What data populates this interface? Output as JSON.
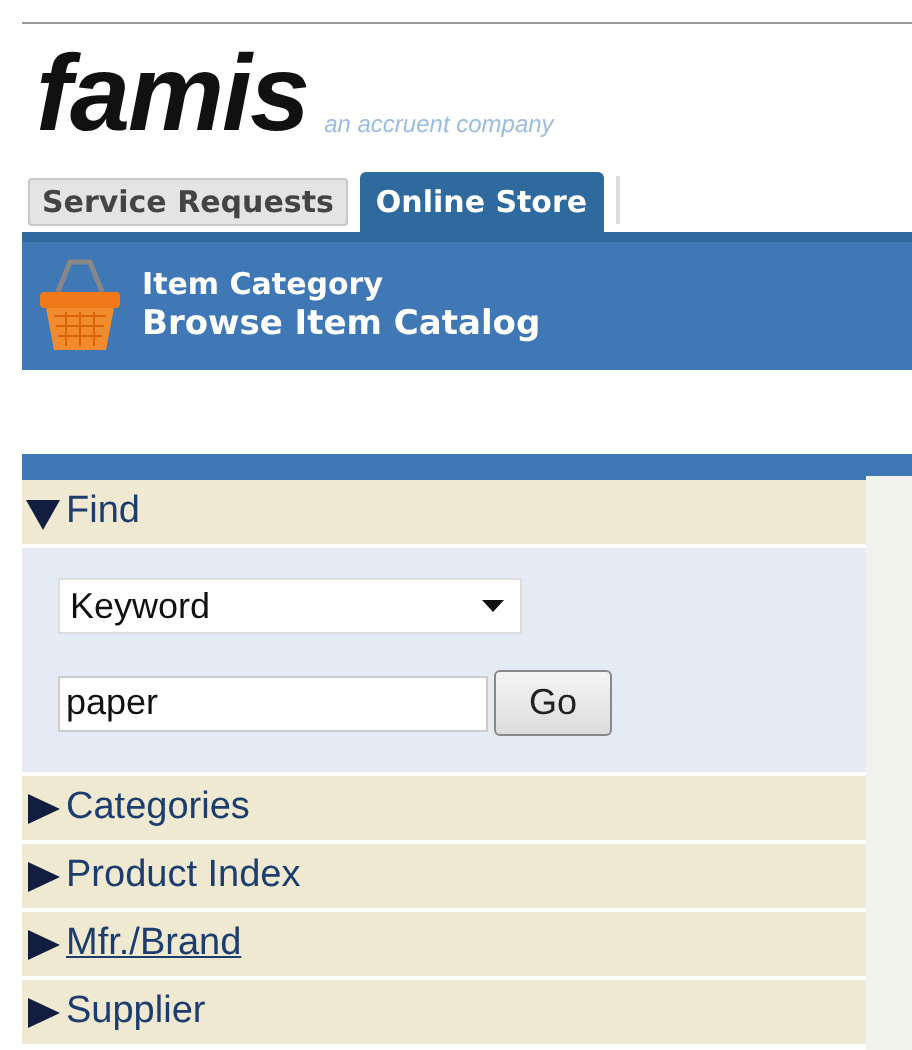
{
  "logo": {
    "brand": "famis",
    "tagline": "an accruent company"
  },
  "tabs": [
    {
      "label": "Service Requests",
      "selected": false
    },
    {
      "label": "Online Store",
      "selected": true
    }
  ],
  "header": {
    "subtitle": "Item Category",
    "title": "Browse Item Catalog"
  },
  "sections": [
    {
      "label": "Find",
      "expanded": true,
      "hovered": false
    },
    {
      "label": "Categories",
      "expanded": false,
      "hovered": false
    },
    {
      "label": "Product Index",
      "expanded": false,
      "hovered": false
    },
    {
      "label": "Mfr./Brand",
      "expanded": false,
      "hovered": true
    },
    {
      "label": "Supplier",
      "expanded": false,
      "hovered": false
    }
  ],
  "find": {
    "search_type": "Keyword",
    "query": "paper",
    "go_button": "Go"
  }
}
